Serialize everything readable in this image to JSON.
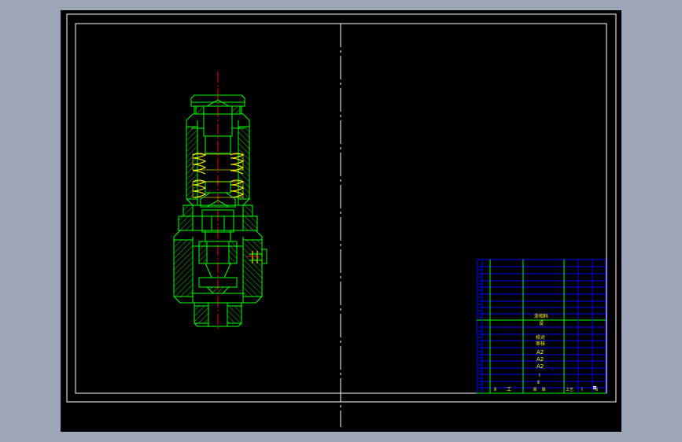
{
  "colors": {
    "background": "#9ca6b6",
    "canvas": "#000000",
    "frame": "#ffffff",
    "outline": "#00ff00",
    "centerline": "#ff0000",
    "spring": "#ffff00",
    "title_block": "#0000ff",
    "title_text": "#ffff00",
    "marker": "#ffffff"
  },
  "title_block": {
    "label_lines": [
      "浙相科",
      "设",
      "校对",
      "审核",
      "A2",
      "A2",
      "A2",
      "Ⅰ",
      "Ⅱ"
    ],
    "bottom_labels": [
      "Ⅱ",
      "工",
      "Ⅲ",
      "Ⅲ",
      "工艺",
      "Ⅰ",
      "Ⅱ"
    ]
  }
}
